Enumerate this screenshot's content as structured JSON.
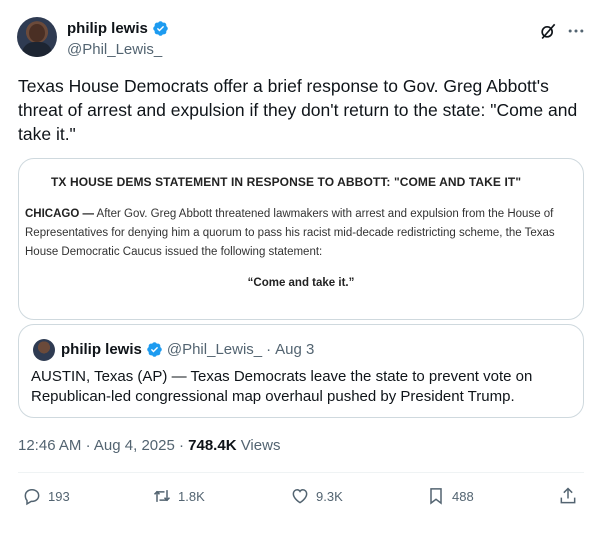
{
  "author": {
    "display_name": "philip lewis",
    "handle": "@Phil_Lewis_"
  },
  "tweet": {
    "text": "Texas House Democrats offer a brief response to Gov. Greg Abbott's threat of arrest and expulsion if they don't return to the state: \"Come and take it.\""
  },
  "image_card": {
    "title": "TX HOUSE DEMS STATEMENT IN RESPONSE TO ABBOTT: \"COME AND TAKE IT\"",
    "dateline": "CHICAGO —",
    "body": " After Gov. Greg Abbott threatened lawmakers with arrest and expulsion from the House of Representatives for denying him a quorum to pass his racist mid-decade redistricting scheme, the Texas House Democratic Caucus issued the following statement:",
    "quote": "“Come and take it.”"
  },
  "quoted_tweet": {
    "display_name": "philip lewis",
    "handle": "@Phil_Lewis_",
    "separator": "·",
    "date": "Aug 3",
    "text": "AUSTIN, Texas (AP) — Texas Democrats leave the state to prevent vote on Republican-led congressional map overhaul pushed by President Trump."
  },
  "meta": {
    "time": "12:46 AM",
    "separator": "·",
    "date": "Aug 4, 2025",
    "separator2": "·",
    "views_count": "748.4K",
    "views_label": "Views"
  },
  "actions": {
    "replies": "193",
    "reposts": "1.8K",
    "likes": "9.3K",
    "bookmarks": "488"
  },
  "colors": {
    "verified": "#1d9bf0",
    "secondary_text": "#536471",
    "border": "#cfd9de"
  },
  "icons": [
    "verified-badge-icon",
    "grok-icon",
    "more-icon",
    "reply-icon",
    "repost-icon",
    "like-icon",
    "bookmark-icon",
    "share-icon"
  ]
}
